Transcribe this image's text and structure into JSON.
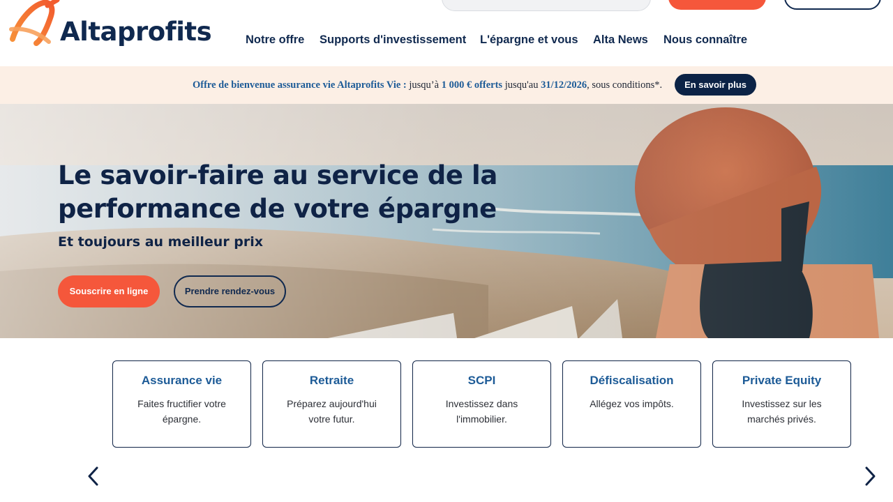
{
  "brand": {
    "name": "Altaprofits"
  },
  "nav": {
    "items": [
      {
        "label": "Notre offre"
      },
      {
        "label": "Supports d'investissement"
      },
      {
        "label": "L'épargne et vous"
      },
      {
        "label": "Alta News"
      },
      {
        "label": "Nous connaître"
      }
    ]
  },
  "promo": {
    "lead": "Offre de bienvenue assurance vie Altaprofits Vie :",
    "t1": " jusqu’à ",
    "amount": "1 000 € offerts",
    "t2": " jusqu'au ",
    "date": "31/12/2026",
    "t3": ", sous conditions*.",
    "button": "En savoir plus"
  },
  "hero": {
    "title_line1": "Le savoir-faire au service de la",
    "title_line2": "performance de votre épargne",
    "subtitle": "Et toujours au meilleur prix",
    "primary_button": "Souscrire en ligne",
    "secondary_button": "Prendre rendez-vous"
  },
  "cards": [
    {
      "title": "Assurance vie",
      "desc": "Faites fructifier votre épargne."
    },
    {
      "title": "Retraite",
      "desc": "Préparez aujourd'hui votre futur."
    },
    {
      "title": "SCPI",
      "desc": "Investissez dans l'immobilier."
    },
    {
      "title": "Défiscalisation",
      "desc": "Allégez vos impôts."
    },
    {
      "title": "Private Equity",
      "desc": "Investissez sur les marchés privés."
    }
  ],
  "icons": {
    "prev": "chevron-left-icon",
    "next": "chevron-right-icon"
  },
  "colors": {
    "navy": "#0f2346",
    "orange": "#f5573b",
    "blue_text": "#1d5b97",
    "promo_bg": "#fcefe5"
  }
}
